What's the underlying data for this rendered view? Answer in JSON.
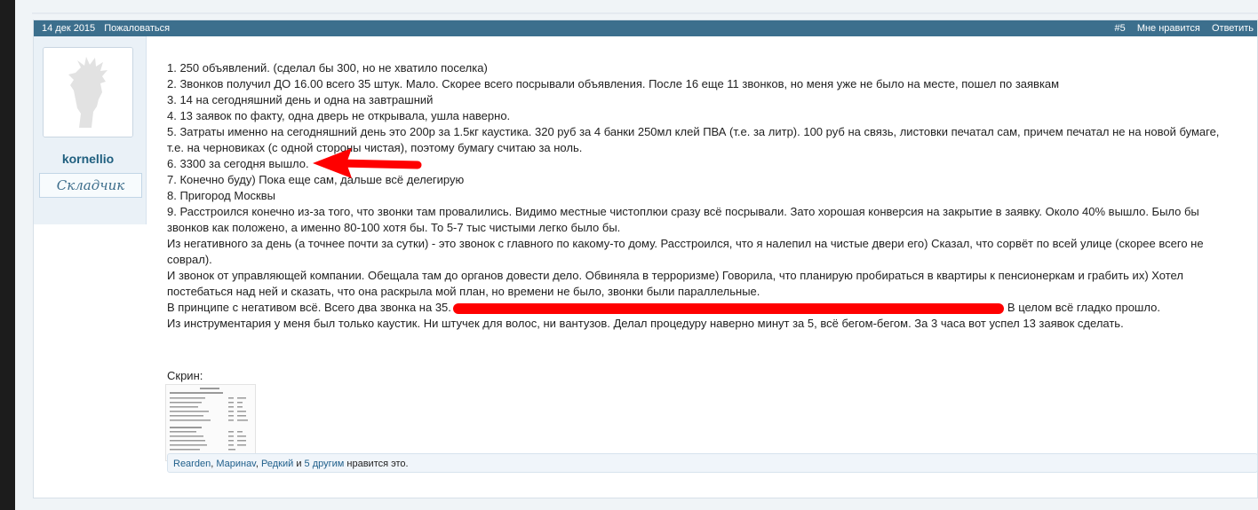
{
  "post": {
    "date": "14 дек 2015",
    "report": "Пожаловаться",
    "number": "#5",
    "like_label": "Мне нравится",
    "reply_label": "Ответить"
  },
  "user": {
    "name": "kornellio",
    "title": "Складчик"
  },
  "content": {
    "lines": [
      "1. 250 объявлений. (сделал бы 300, но не хватило поселка)",
      "2. Звонков получил ДО 16.00 всего 35 штук. Мало. Скорее всего посрывали объявления. После 16 еще 11 звонков, но меня уже не было на месте, пошел по заявкам",
      "3. 14 на сегодняшний день и одна на завтрашний",
      "4. 13 заявок по факту, одна дверь не открывала, ушла наверно.",
      "5. Затраты именно на сегодняшний день это 200р за 1.5кг каустика. 320 руб за 4 банки 250мл клей ПВА (т.е. за литр). 100 руб на связь, листовки печатал сам, причем печатал не на новой бумаге, т.е. на черновиках (с одной стороны чистая), поэтому бумагу считаю за ноль.",
      "6. 3300 за сегодня вышло.",
      "7. Конечно буду) Пока еще сам, дальше всё делегирую",
      "8. Пригород Москвы",
      "9. Расстроился конечно из-за того, что звонки там провалились. Видимо местные чистоплюи сразу всё посрывали. Зато хорошая конверсия на закрытие в заявку. Около 40% вышло. Было бы звонков как положено, а именно 80-100 хотя бы. То 5-7 тыс чистыми легко было бы.",
      "Из негативного за день (а точнее почти за сутки) - это звонок с главного по какому-то дому. Расстроился, что я налепил на чистые двери его) Сказал, что сорвёт по всей улице (скорее всего не соврал).",
      "И звонок от управляющей компании. Обещала там до органов довести дело. Обвиняла в терроризме) Говорила, что планирую пробираться в квартиры к пенсионеркам и грабить их) Хотел постебаться над ней и сказать, что она раскрыла мой план, но времени не было, звонки были параллельные."
    ],
    "line12_start": "В принципе с негативом всё. Всего два звонка на 35.",
    "line12_end": "В целом всё гладко прошло.",
    "line13": "Из инструментария у меня был только каустик. Ни штучек для волос, ни вантузов. Делал процедуру наверно минут за 5, всё бегом-бегом. За 3 часа вот успел 13 заявок сделать.",
    "screenshot_label": "Скрин:"
  },
  "likes": {
    "user1": "Rearden",
    "user2": "Маринаv",
    "user3": "Редкий",
    "conj": "и",
    "others": "5 другим",
    "suffix": "нравится это."
  },
  "colors": {
    "header_bg": "#3c6f8d",
    "link": "#1f5f8b",
    "annotation_arrow": "#ff0000",
    "redaction": "#ff0000"
  }
}
